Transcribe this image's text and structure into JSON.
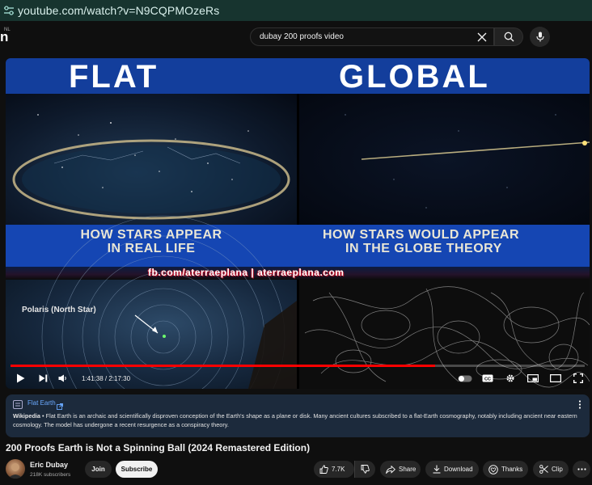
{
  "browser": {
    "url": "youtube.com/watch?v=N9CQPMOzeRs"
  },
  "header": {
    "logo_fragment": "n",
    "region_code": "NL",
    "search_query": "dubay 200 proofs video"
  },
  "video_frame": {
    "left_title": "FLAT",
    "right_title": "GLOBAL",
    "left_caption_1": "HOW STARS APPEAR",
    "left_caption_2": "IN REAL LIFE",
    "right_caption_1": "HOW STARS WOULD APPEAR",
    "right_caption_2": "IN THE GLOBE THEORY",
    "watermark": "fb.com/aterraeplana  |  aterraeplana.com",
    "polaris_label": "Polaris (North Star)"
  },
  "player": {
    "time_display": "1:41:38 / 2:17:30",
    "progress_fraction": 0.7393
  },
  "info_panel": {
    "title": "Flat Earth",
    "source": "Wikipedia",
    "body": "Flat Earth is an archaic and scientifically disproven conception of the Earth's shape as a plane or disk. Many ancient cultures subscribed to a flat-Earth cosmography, notably including ancient near eastern cosmology. The model has undergone a recent resurgence as a conspiracy theory."
  },
  "video": {
    "title": "200 Proofs Earth is Not a Spinning Ball (2024 Remastered Edition)",
    "channel": "Eric Dubay",
    "subscribers": "218K subscribers",
    "join_label": "Join",
    "subscribe_label": "Subscribe",
    "likes": "7.7K",
    "share_label": "Share",
    "download_label": "Download",
    "thanks_label": "Thanks",
    "clip_label": "Clip"
  },
  "colors": {
    "progress": "#ff0000",
    "accent_link": "#6aa9ff",
    "frame_blue": "#1546b3"
  }
}
